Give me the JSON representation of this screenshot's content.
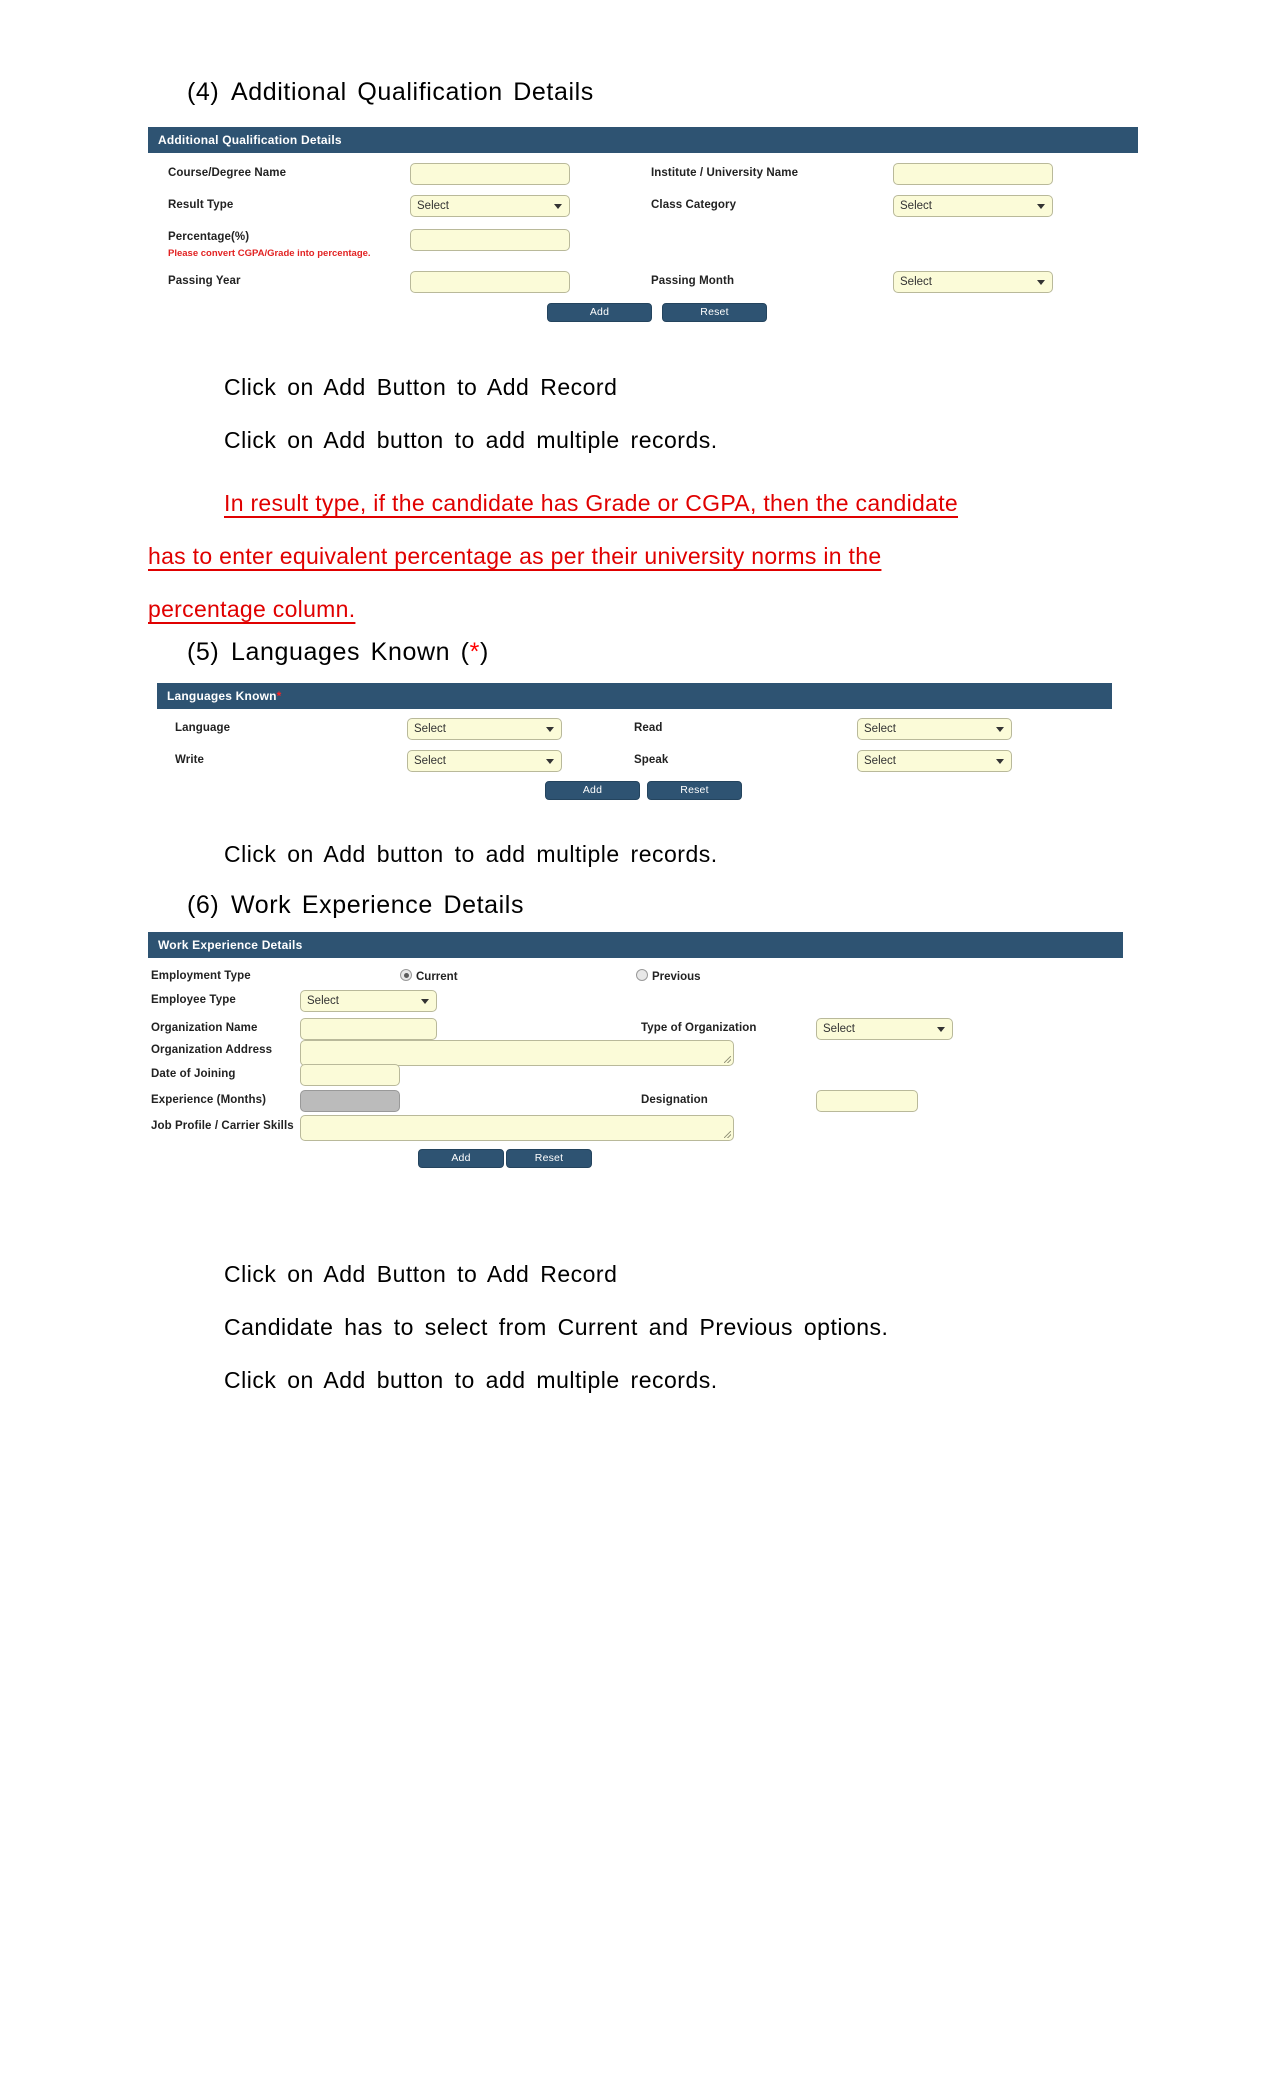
{
  "colors": {
    "panel_header_bg": "#2e5372",
    "field_bg": "#fbfbd8",
    "field_border": "#b9b99a",
    "disabled_bg": "#bbbbbb",
    "button_bg": "#2e5372",
    "red_text": "#e00000",
    "note_red": "#e22222"
  },
  "sections": {
    "additional_qualification": {
      "heading_number": "(4)",
      "heading_text": "Additional  Qualification  Details",
      "panel_title": "Additional Qualification Details",
      "fields": {
        "course_degree_name": {
          "label": "Course/Degree Name",
          "value": ""
        },
        "institute_university_name": {
          "label": "Institute / University Name",
          "value": ""
        },
        "result_type": {
          "label": "Result Type",
          "value": "Select"
        },
        "class_category": {
          "label": "Class Category",
          "value": "Select"
        },
        "percentage": {
          "label": "Percentage(%)",
          "note": "Please convert CGPA/Grade into percentage.",
          "value": ""
        },
        "passing_year": {
          "label": "Passing Year",
          "value": ""
        },
        "passing_month": {
          "label": "Passing Month",
          "value": "Select"
        }
      },
      "buttons": {
        "add": "Add",
        "reset": "Reset"
      },
      "notes": [
        "Click  on  Add  Button  to  Add  Record",
        "Click  on  Add  button  to  add  multiple  records."
      ],
      "red_note": {
        "line1_lead": "In  result  type,  if  the  candidate  has  Grade  or  CGPA,  then  the  candidate",
        "line2": "has   to   enter   equivalent   percentage   as   per   their   university   norms   in   the",
        "line3": "percentage  column."
      }
    },
    "languages_known": {
      "heading_number": "(5)",
      "heading_text": "Languages  Known  (",
      "heading_star": "*",
      "heading_tail": ")",
      "panel_title": "Languages Known",
      "panel_title_required": "*",
      "fields": {
        "language": {
          "label": "Language",
          "value": "Select"
        },
        "read": {
          "label": "Read",
          "value": "Select"
        },
        "write": {
          "label": "Write",
          "value": "Select"
        },
        "speak": {
          "label": "Speak",
          "value": "Select"
        }
      },
      "buttons": {
        "add": "Add",
        "reset": "Reset"
      },
      "notes": [
        "Click  on  Add  button  to  add  multiple  records."
      ]
    },
    "work_experience": {
      "heading_number": "(6)",
      "heading_text": "Work  Experience  Details",
      "panel_title": "Work Experience Details",
      "fields": {
        "employment_type": {
          "label": "Employment Type",
          "options": [
            {
              "label": "Current",
              "selected": true
            },
            {
              "label": "Previous",
              "selected": false
            }
          ]
        },
        "employee_type": {
          "label": "Employee Type",
          "value": "Select"
        },
        "organization_name": {
          "label": "Organization Name",
          "value": ""
        },
        "type_of_organization": {
          "label": "Type of Organization",
          "value": "Select"
        },
        "organization_address": {
          "label": "Organization Address",
          "value": ""
        },
        "date_of_joining": {
          "label": "Date of Joining",
          "value": ""
        },
        "experience_months": {
          "label": "Experience (Months)",
          "value": "",
          "disabled": true
        },
        "designation": {
          "label": "Designation",
          "value": ""
        },
        "job_profile": {
          "label": "Job Profile / Carrier Skills",
          "value": ""
        }
      },
      "buttons": {
        "add": "Add",
        "reset": "Reset"
      },
      "notes": [
        "Click  on  Add  Button  to  Add  Record",
        "Candidate  has  to  select  from  Current  and  Previous  options.",
        "Click  on  Add  button  to  add  multiple  records."
      ]
    }
  }
}
